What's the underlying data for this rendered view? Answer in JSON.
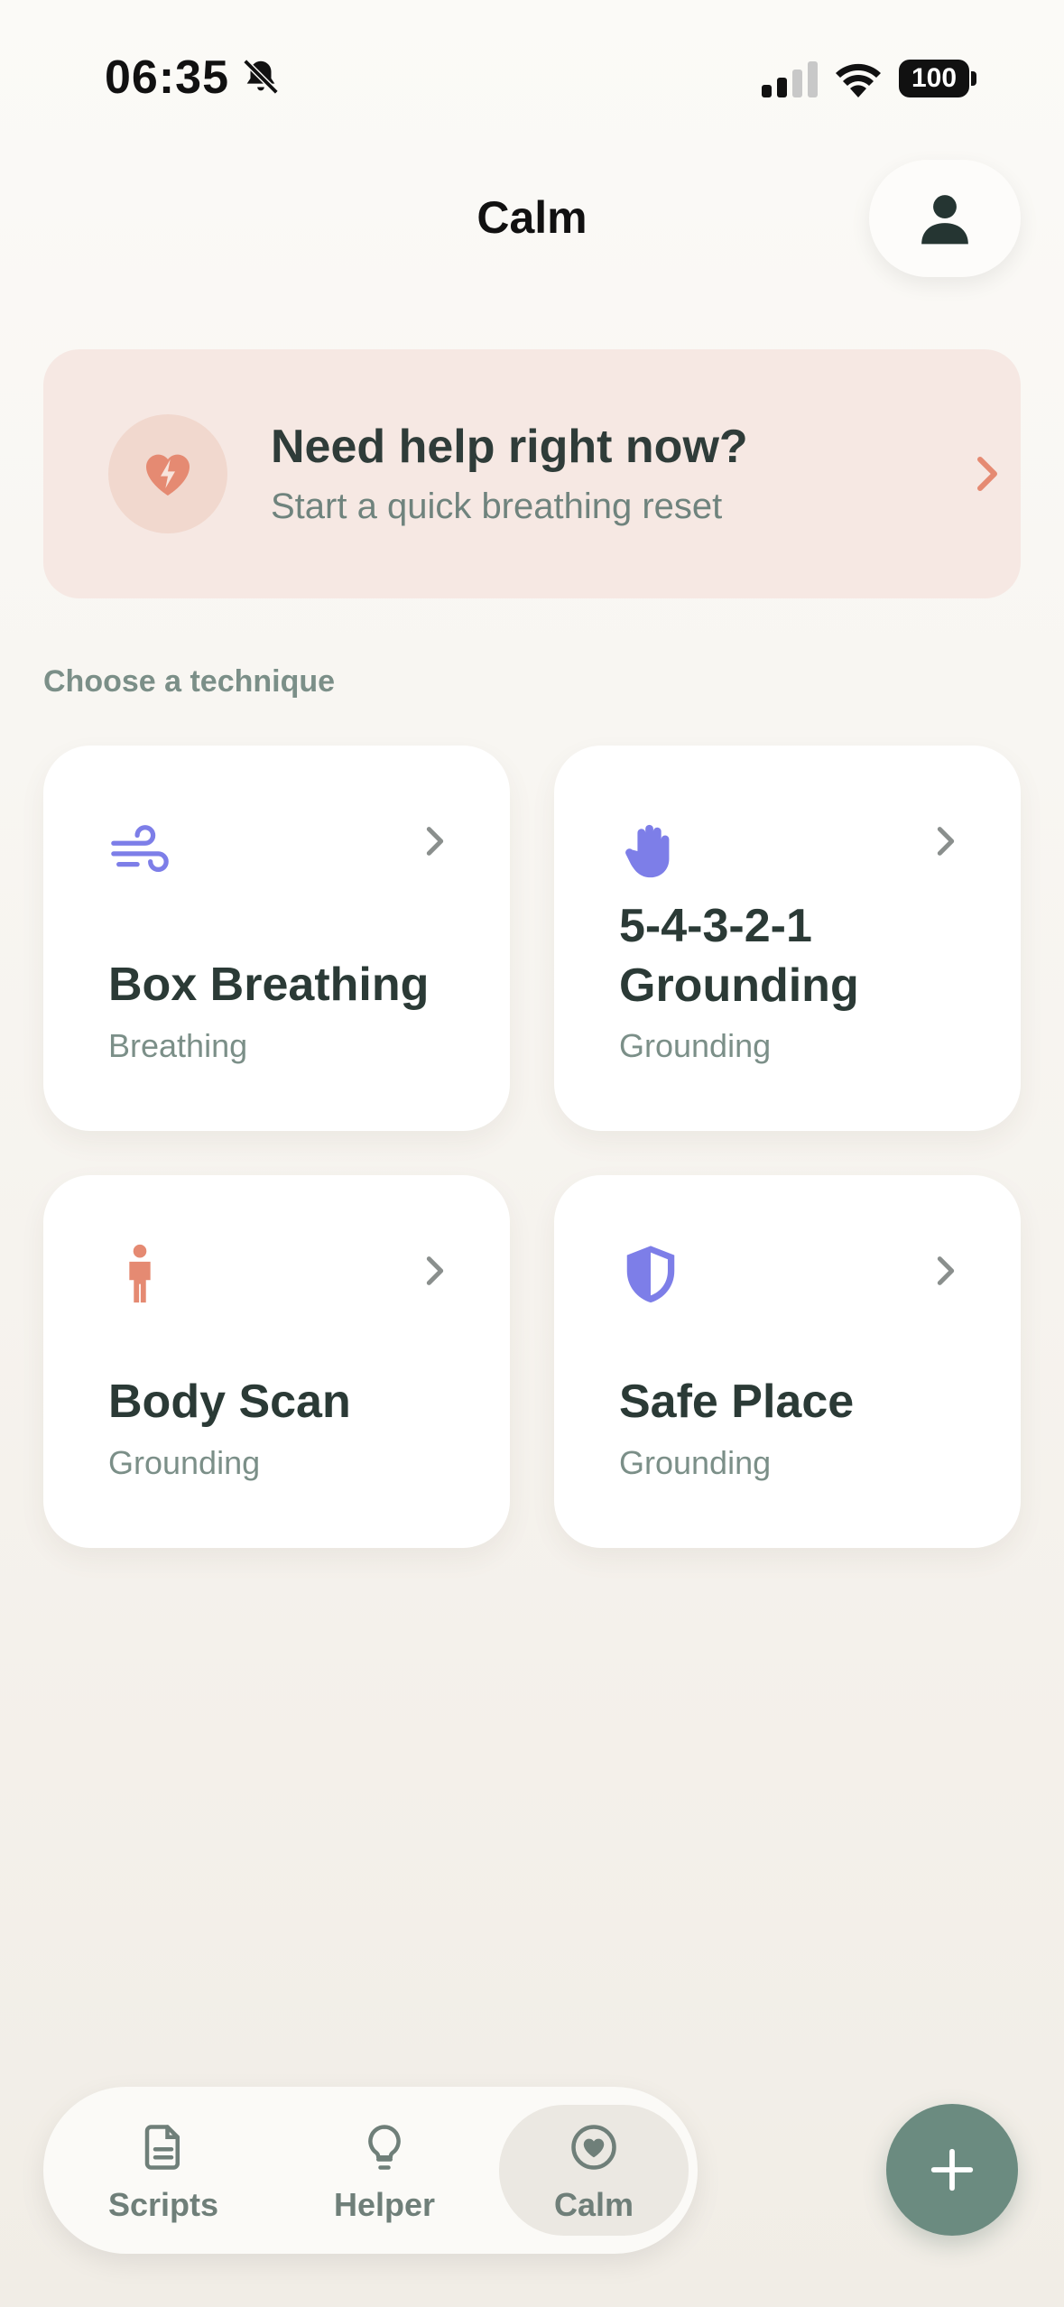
{
  "status_bar": {
    "time": "06:35",
    "battery": "100"
  },
  "header": {
    "title": "Calm"
  },
  "help_banner": {
    "title": "Need help right now?",
    "subtitle": "Start a quick breathing reset",
    "icon": "heart-bolt-icon"
  },
  "section_label": "Choose a technique",
  "techniques": [
    {
      "title": "Box Breathing",
      "category": "Breathing",
      "icon": "wind-icon"
    },
    {
      "title": "5-4-3-2-1 Grounding",
      "category": "Grounding",
      "icon": "hand-icon"
    },
    {
      "title": "Body Scan",
      "category": "Grounding",
      "icon": "person-icon"
    },
    {
      "title": "Safe Place",
      "category": "Grounding",
      "icon": "shield-icon"
    }
  ],
  "bottom_nav": {
    "items": [
      {
        "label": "Scripts",
        "icon": "document-icon"
      },
      {
        "label": "Helper",
        "icon": "lightbulb-icon"
      },
      {
        "label": "Calm",
        "icon": "heart-circle-icon",
        "active": true
      }
    ]
  },
  "colors": {
    "accent_purple": "#7d7ee8",
    "accent_coral": "#e58a72",
    "fab_green": "#6b8b80",
    "text_dark": "#2b3a36",
    "text_muted": "#7b8f88",
    "banner_bg": "#f6e8e3"
  }
}
